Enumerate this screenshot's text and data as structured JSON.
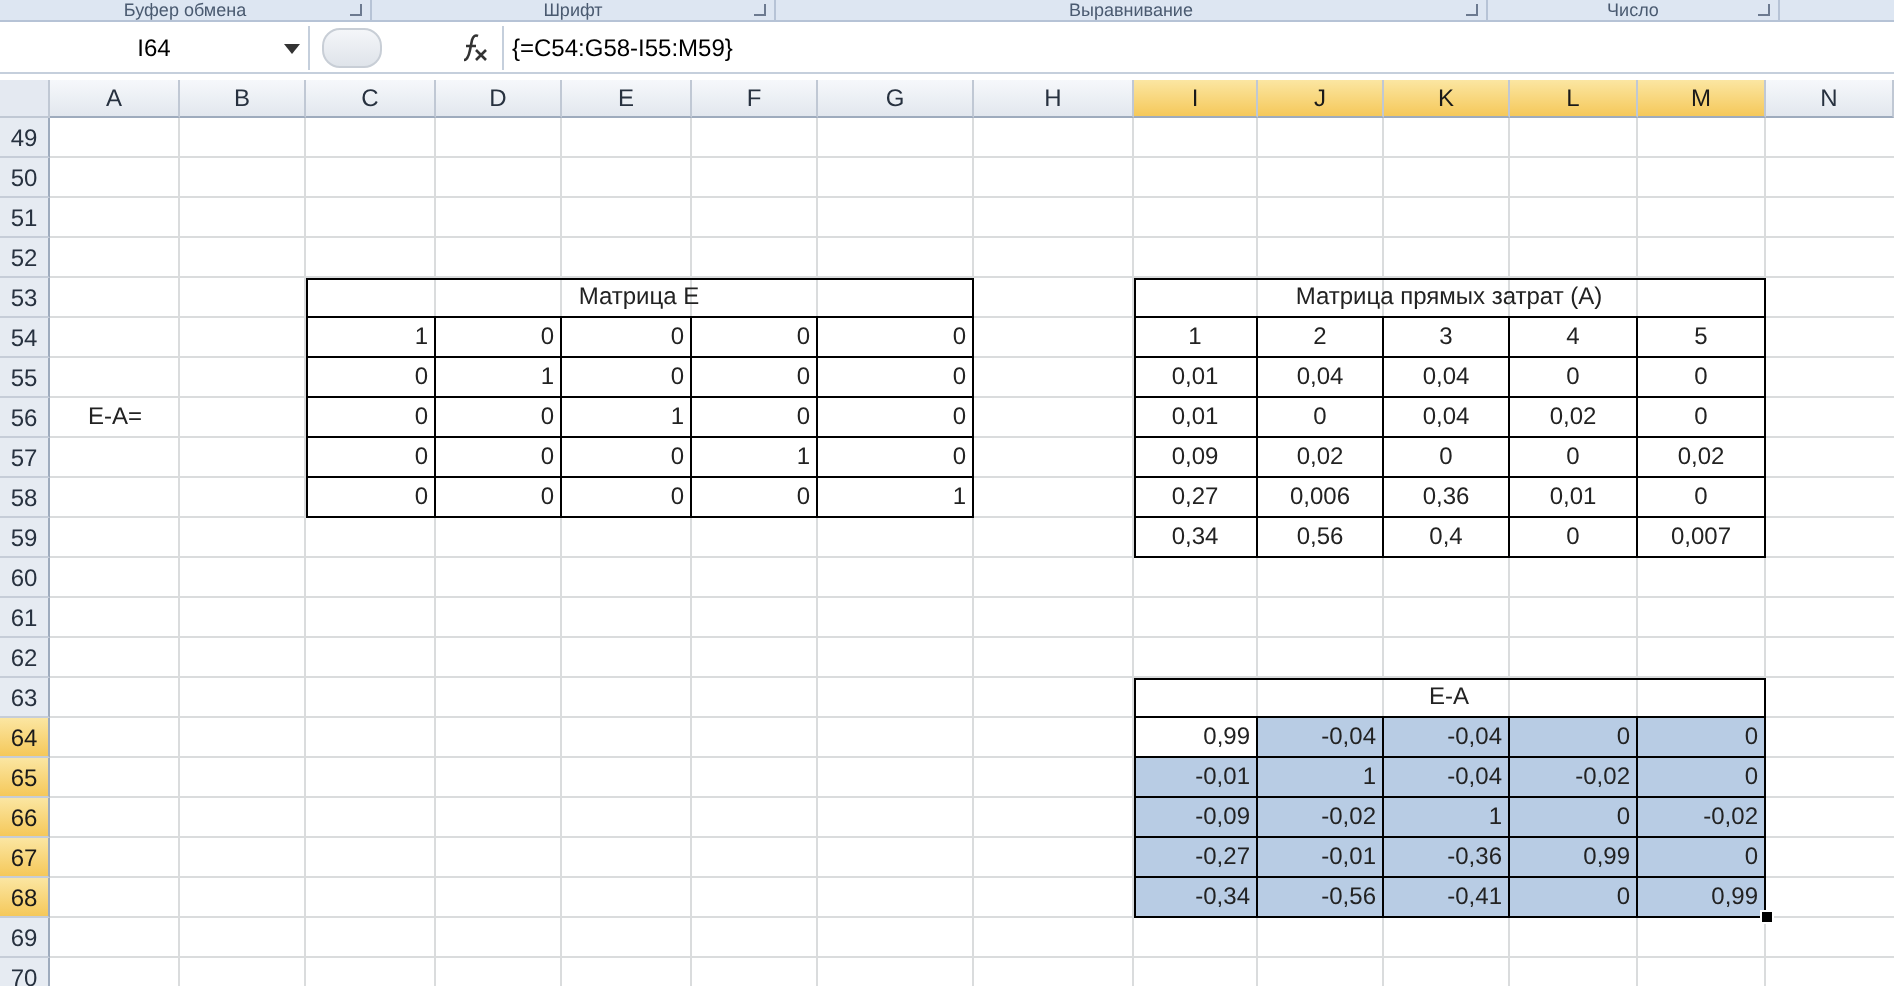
{
  "ribbon_groups": [
    {
      "label": "Буфер обмена"
    },
    {
      "label": "Шрифт"
    },
    {
      "label": "Выравнивание"
    },
    {
      "label": "Число"
    }
  ],
  "name_box": "I64",
  "formula": "{=C54:G58-I55:M59}",
  "columns": [
    {
      "label": "A",
      "selected": false
    },
    {
      "label": "B",
      "selected": false
    },
    {
      "label": "C",
      "selected": false
    },
    {
      "label": "D",
      "selected": false
    },
    {
      "label": "E",
      "selected": false
    },
    {
      "label": "F",
      "selected": false
    },
    {
      "label": "G",
      "selected": false
    },
    {
      "label": "H",
      "selected": false
    },
    {
      "label": "I",
      "selected": true
    },
    {
      "label": "J",
      "selected": true
    },
    {
      "label": "K",
      "selected": true
    },
    {
      "label": "L",
      "selected": true
    },
    {
      "label": "M",
      "selected": true
    },
    {
      "label": "N",
      "selected": false
    }
  ],
  "rows": [
    {
      "label": "49",
      "selected": false
    },
    {
      "label": "50",
      "selected": false
    },
    {
      "label": "51",
      "selected": false
    },
    {
      "label": "52",
      "selected": false
    },
    {
      "label": "53",
      "selected": false
    },
    {
      "label": "54",
      "selected": false
    },
    {
      "label": "55",
      "selected": false
    },
    {
      "label": "56",
      "selected": false
    },
    {
      "label": "57",
      "selected": false
    },
    {
      "label": "58",
      "selected": false
    },
    {
      "label": "59",
      "selected": false
    },
    {
      "label": "60",
      "selected": false
    },
    {
      "label": "61",
      "selected": false
    },
    {
      "label": "62",
      "selected": false
    },
    {
      "label": "63",
      "selected": false
    },
    {
      "label": "64",
      "selected": true
    },
    {
      "label": "65",
      "selected": true
    },
    {
      "label": "66",
      "selected": true
    },
    {
      "label": "67",
      "selected": true
    },
    {
      "label": "68",
      "selected": true
    },
    {
      "label": "69",
      "selected": false
    },
    {
      "label": "70",
      "selected": false
    }
  ],
  "label_cell": "E-A=",
  "matrix_e": {
    "title": "Матрица E",
    "rows": [
      [
        "1",
        "0",
        "0",
        "0",
        "0"
      ],
      [
        "0",
        "1",
        "0",
        "0",
        "0"
      ],
      [
        "0",
        "0",
        "1",
        "0",
        "0"
      ],
      [
        "0",
        "0",
        "0",
        "1",
        "0"
      ],
      [
        "0",
        "0",
        "0",
        "0",
        "1"
      ]
    ]
  },
  "matrix_a": {
    "title": "Матрица прямых затрат (A)",
    "header": [
      "1",
      "2",
      "3",
      "4",
      "5"
    ],
    "rows": [
      [
        "0,01",
        "0,04",
        "0,04",
        "0",
        "0"
      ],
      [
        "0,01",
        "0",
        "0,04",
        "0,02",
        "0"
      ],
      [
        "0,09",
        "0,02",
        "0",
        "0",
        "0,02"
      ],
      [
        "0,27",
        "0,006",
        "0,36",
        "0,01",
        "0"
      ],
      [
        "0,34",
        "0,56",
        "0,4",
        "0",
        "0,007"
      ]
    ]
  },
  "e_minus_a": {
    "title": "E-A",
    "rows": [
      [
        {
          "value": "0,99",
          "selected": false
        },
        {
          "value": "-0,04",
          "selected": true
        },
        {
          "value": "-0,04",
          "selected": true
        },
        {
          "value": "0",
          "selected": true
        },
        {
          "value": "0",
          "selected": true
        }
      ],
      [
        {
          "value": "-0,01",
          "selected": true
        },
        {
          "value": "1",
          "selected": true
        },
        {
          "value": "-0,04",
          "selected": true
        },
        {
          "value": "-0,02",
          "selected": true
        },
        {
          "value": "0",
          "selected": true
        }
      ],
      [
        {
          "value": "-0,09",
          "selected": true
        },
        {
          "value": "-0,02",
          "selected": true
        },
        {
          "value": "1",
          "selected": true
        },
        {
          "value": "0",
          "selected": true
        },
        {
          "value": "-0,02",
          "selected": true
        }
      ],
      [
        {
          "value": "-0,27",
          "selected": true
        },
        {
          "value": "-0,01",
          "selected": true
        },
        {
          "value": "-0,36",
          "selected": true
        },
        {
          "value": "0,99",
          "selected": true
        },
        {
          "value": "0",
          "selected": true
        }
      ],
      [
        {
          "value": "-0,34",
          "selected": true
        },
        {
          "value": "-0,56",
          "selected": true
        },
        {
          "value": "-0,41",
          "selected": true
        },
        {
          "value": "0",
          "selected": true
        },
        {
          "value": "0,99",
          "selected": true
        }
      ]
    ]
  }
}
